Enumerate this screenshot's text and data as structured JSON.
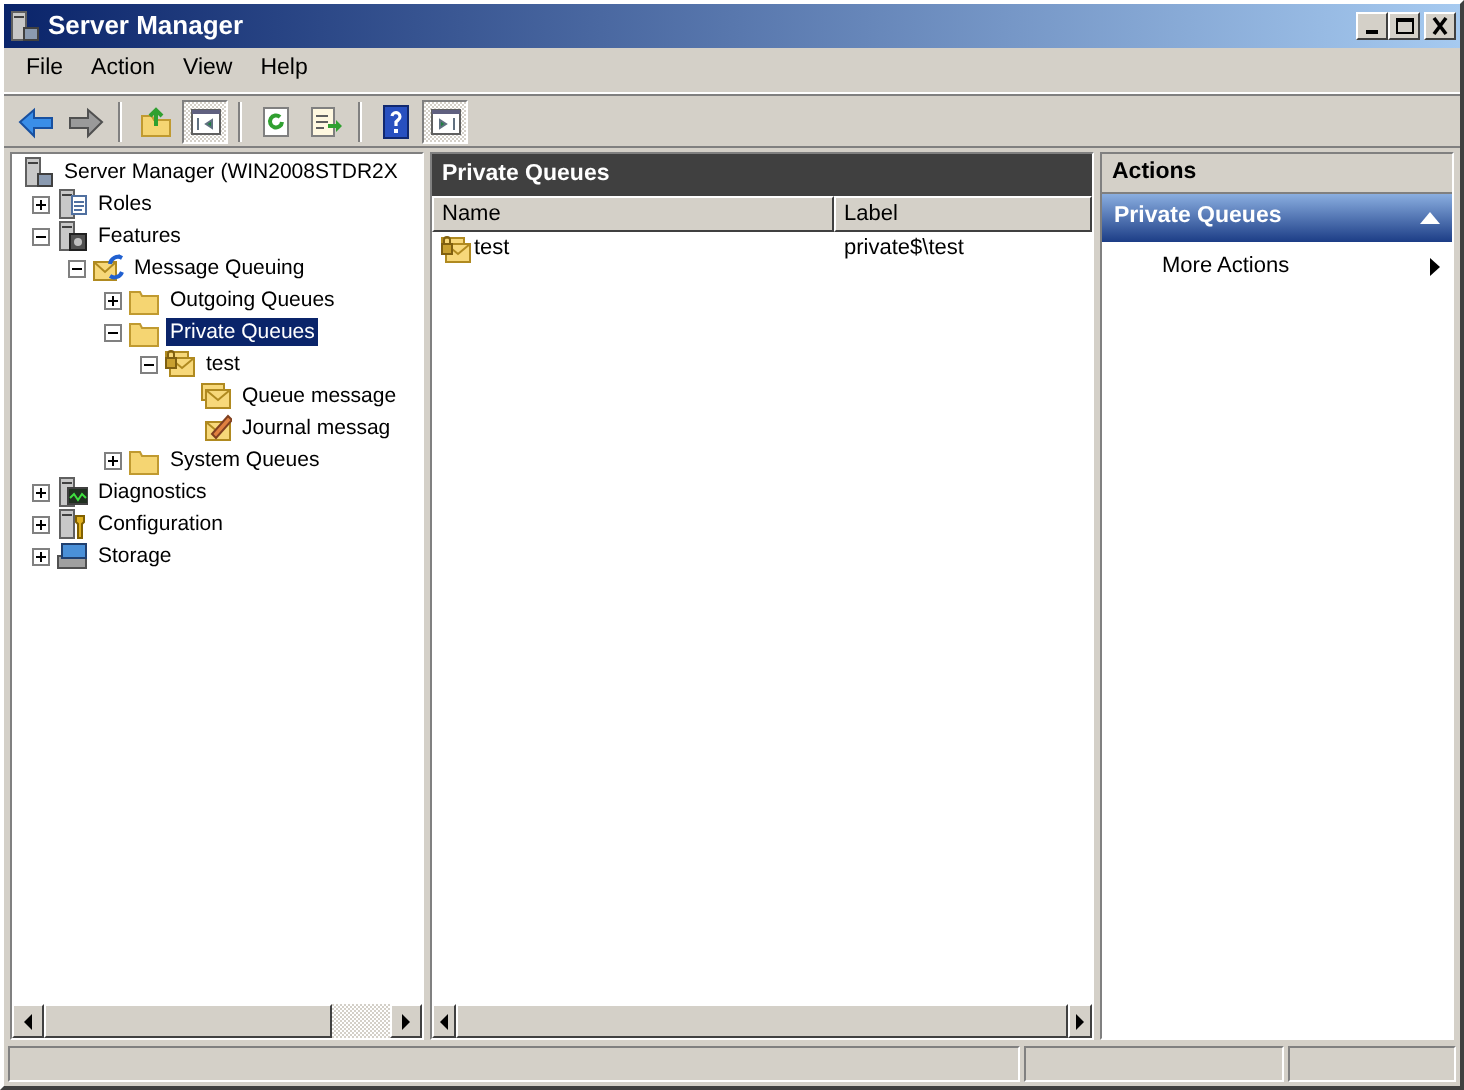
{
  "window": {
    "title": "Server Manager"
  },
  "menu": [
    "File",
    "Action",
    "View",
    "Help"
  ],
  "toolbar": [
    {
      "kind": "back",
      "pressed": false
    },
    {
      "kind": "forward",
      "pressed": false
    },
    {
      "kind": "separator"
    },
    {
      "kind": "up",
      "pressed": false
    },
    {
      "kind": "tree-toggle",
      "pressed": true
    },
    {
      "kind": "separator"
    },
    {
      "kind": "refresh",
      "pressed": false
    },
    {
      "kind": "export",
      "pressed": false
    },
    {
      "kind": "separator"
    },
    {
      "kind": "help",
      "pressed": false
    },
    {
      "kind": "action-toggle",
      "pressed": true
    }
  ],
  "tree": [
    {
      "label": "Server Manager (WIN2008STDR2X",
      "kind": "server",
      "selected": false,
      "children": [
        {
          "label": "Roles",
          "kind": "roles",
          "expanded": false,
          "selected": false
        },
        {
          "label": "Features",
          "kind": "features",
          "expanded": true,
          "selected": false,
          "children": [
            {
              "label": "Message Queuing",
              "kind": "queuing",
              "expanded": true,
              "selected": false,
              "children": [
                {
                  "label": "Outgoing Queues",
                  "kind": "folder",
                  "expanded": false,
                  "selected": false
                },
                {
                  "label": "Private Queues",
                  "kind": "folder",
                  "expanded": true,
                  "selected": true,
                  "children": [
                    {
                      "label": "test",
                      "kind": "queue",
                      "expanded": true,
                      "selected": false,
                      "children": [
                        {
                          "label": "Queue message",
                          "kind": "messages",
                          "selected": false
                        },
                        {
                          "label": "Journal messag",
                          "kind": "journal",
                          "selected": false
                        }
                      ]
                    }
                  ]
                },
                {
                  "label": "System Queues",
                  "kind": "folder",
                  "expanded": false,
                  "selected": false
                }
              ]
            }
          ]
        },
        {
          "label": "Diagnostics",
          "kind": "diagnostics",
          "expanded": false,
          "selected": false
        },
        {
          "label": "Configuration",
          "kind": "configuration",
          "expanded": false,
          "selected": false
        },
        {
          "label": "Storage",
          "kind": "storage",
          "expanded": false,
          "selected": false
        }
      ]
    }
  ],
  "content": {
    "title": "Private Queues",
    "columns": [
      "Name",
      "Label"
    ],
    "rows": [
      {
        "kind": "queue",
        "cells": [
          "test",
          "private$\\test"
        ],
        "selected": false
      }
    ]
  },
  "actions": {
    "title": "Actions",
    "section": {
      "title": "Private Queues",
      "expanded": true
    },
    "items": [
      {
        "label": "More Actions",
        "submenu": true
      }
    ]
  }
}
